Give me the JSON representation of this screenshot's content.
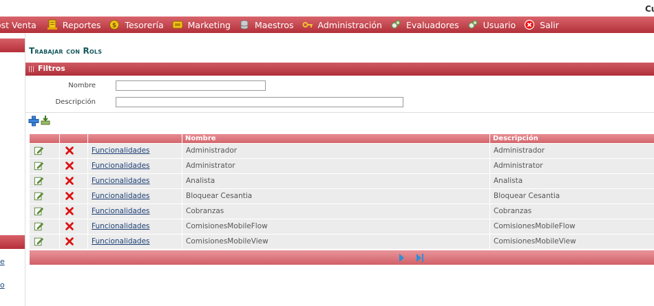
{
  "header": {
    "user_text": "Cu"
  },
  "menu": {
    "items": [
      {
        "label": "ost Venta",
        "icon": "none"
      },
      {
        "label": "Reportes",
        "icon": "report-icon"
      },
      {
        "label": "Tesorería",
        "icon": "coin-icon"
      },
      {
        "label": "Marketing",
        "icon": "marketing-icon"
      },
      {
        "label": "Maestros",
        "icon": "database-icon"
      },
      {
        "label": "Administración",
        "icon": "key-icon"
      },
      {
        "label": "Evaluadores",
        "icon": "gears-icon"
      },
      {
        "label": "Usuario",
        "icon": "gears-icon"
      },
      {
        "label": "Salir",
        "icon": "exit-icon"
      }
    ]
  },
  "sidebar": {
    "links": [
      "e",
      "o"
    ]
  },
  "page": {
    "title": "Trabajar con Rols"
  },
  "filters": {
    "title": "Filtros",
    "nombre_label": "Nombre",
    "nombre_value": "",
    "descripcion_label": "Descripción",
    "descripcion_value": ""
  },
  "grid": {
    "columns": [
      "",
      "",
      "",
      "Nombre",
      "Descripción"
    ],
    "rows": [
      {
        "link": "Funcionalidades",
        "nombre": "Administrador",
        "descripcion": "Administrador"
      },
      {
        "link": "Funcionalidades",
        "nombre": "Administrator",
        "descripcion": "Administrator"
      },
      {
        "link": "Funcionalidades",
        "nombre": "Analista",
        "descripcion": "Analista"
      },
      {
        "link": "Funcionalidades",
        "nombre": "Bloquear Cesantia",
        "descripcion": "Bloquear Cesantia"
      },
      {
        "link": "Funcionalidades",
        "nombre": "Cobranzas",
        "descripcion": "Cobranzas"
      },
      {
        "link": "Funcionalidades",
        "nombre": "ComisionesMobileFlow",
        "descripcion": "ComisionesMobileFlow"
      },
      {
        "link": "Funcionalidades",
        "nombre": "ComisionesMobileView",
        "descripcion": "ComisionesMobileView"
      }
    ]
  },
  "colors": {
    "menu_bar": "#b8333d",
    "title": "#13575d",
    "link": "#1c3f75",
    "row_bg": "#ececec",
    "pager": "#2f8fd6"
  }
}
